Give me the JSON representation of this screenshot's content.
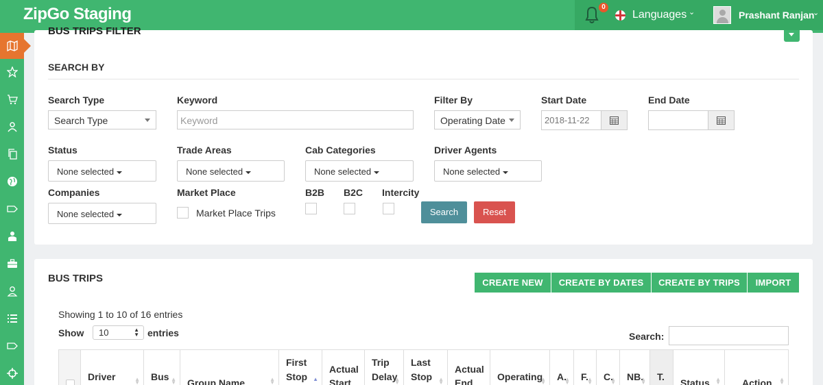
{
  "app": {
    "title": "ZipGo Staging"
  },
  "header": {
    "notifications_count": "0",
    "languages_label": "Languages",
    "user_name": "Prashant Ranjan"
  },
  "sidebar": {
    "items": [
      {
        "icon": "map-icon",
        "active": true
      },
      {
        "icon": "star-icon"
      },
      {
        "icon": "cart-icon"
      },
      {
        "icon": "user-icon"
      },
      {
        "icon": "copy-icon"
      },
      {
        "icon": "globe-icon"
      },
      {
        "icon": "tag-icon"
      },
      {
        "icon": "agent-icon"
      },
      {
        "icon": "briefcase-icon"
      },
      {
        "icon": "person-outline-icon"
      },
      {
        "icon": "list-icon"
      },
      {
        "icon": "label-icon"
      },
      {
        "icon": "crosshair-icon"
      }
    ]
  },
  "filter": {
    "panel_title": "BUS TRIPS FILTER",
    "section_title": "SEARCH BY",
    "search_type": {
      "label": "Search Type",
      "value": "Search Type"
    },
    "keyword": {
      "label": "Keyword",
      "placeholder": "Keyword"
    },
    "filter_by": {
      "label": "Filter By",
      "value": "Operating Date"
    },
    "start_date": {
      "label": "Start Date",
      "value": "2018-11-22"
    },
    "end_date": {
      "label": "End Date",
      "value": ""
    },
    "status": {
      "label": "Status",
      "value": "None selected"
    },
    "trade_areas": {
      "label": "Trade Areas",
      "value": "None selected"
    },
    "cab_categories": {
      "label": "Cab Categories",
      "value": "None selected"
    },
    "driver_agents": {
      "label": "Driver Agents",
      "value": "None selected"
    },
    "companies": {
      "label": "Companies",
      "value": "None selected"
    },
    "market_place": {
      "label": "Market Place",
      "checkbox_label": "Market Place Trips"
    },
    "b2b_label": "B2B",
    "b2c_label": "B2C",
    "intercity_label": "Intercity",
    "search_button": "Search",
    "reset_button": "Reset"
  },
  "trips": {
    "title": "BUS TRIPS",
    "buttons": {
      "create_new": "CREATE NEW",
      "create_by_dates": "CREATE BY DATES",
      "create_by_trips": "CREATE BY TRIPS",
      "import": "IMPORT"
    },
    "info": "Showing 1 to 10 of 16 entries",
    "show_label": "Show",
    "page_size": "10",
    "entries_label": "entries",
    "search_label": "Search:",
    "columns": [
      {
        "l1": "",
        "l2": "",
        "l3": ""
      },
      {
        "l1": "Driver",
        "l2": "",
        "l3": ""
      },
      {
        "l1": "Bus",
        "l2": "",
        "l3": ""
      },
      {
        "l1": "Group Name",
        "l2": "",
        "l3": ""
      },
      {
        "l1": "First",
        "l2": "Stop",
        "l3": ""
      },
      {
        "l1": "Actual",
        "l2": "Start",
        "l3": ""
      },
      {
        "l1": "Trip",
        "l2": "Delay",
        "l3": ""
      },
      {
        "l1": "Last",
        "l2": "Stop",
        "l3": ""
      },
      {
        "l1": "Actual",
        "l2": "End",
        "l3": ""
      },
      {
        "l1": "Operating",
        "l2": "",
        "l3": ""
      },
      {
        "l1": "A.",
        "l2": "",
        "l3": ""
      },
      {
        "l1": "F.",
        "l2": "",
        "l3": ""
      },
      {
        "l1": "C.",
        "l2": "",
        "l3": ""
      },
      {
        "l1": "NB.",
        "l2": "",
        "l3": ""
      },
      {
        "l1": "T.",
        "l2": "",
        "l3": ""
      },
      {
        "l1": "Status",
        "l2": "",
        "l3": ""
      },
      {
        "l1": "Action",
        "l2": "",
        "l3": ""
      }
    ]
  },
  "colors": {
    "primary": "#40b670",
    "accent": "#e6752f",
    "search_btn": "#4f8f9a",
    "reset_btn": "#d9534f"
  }
}
